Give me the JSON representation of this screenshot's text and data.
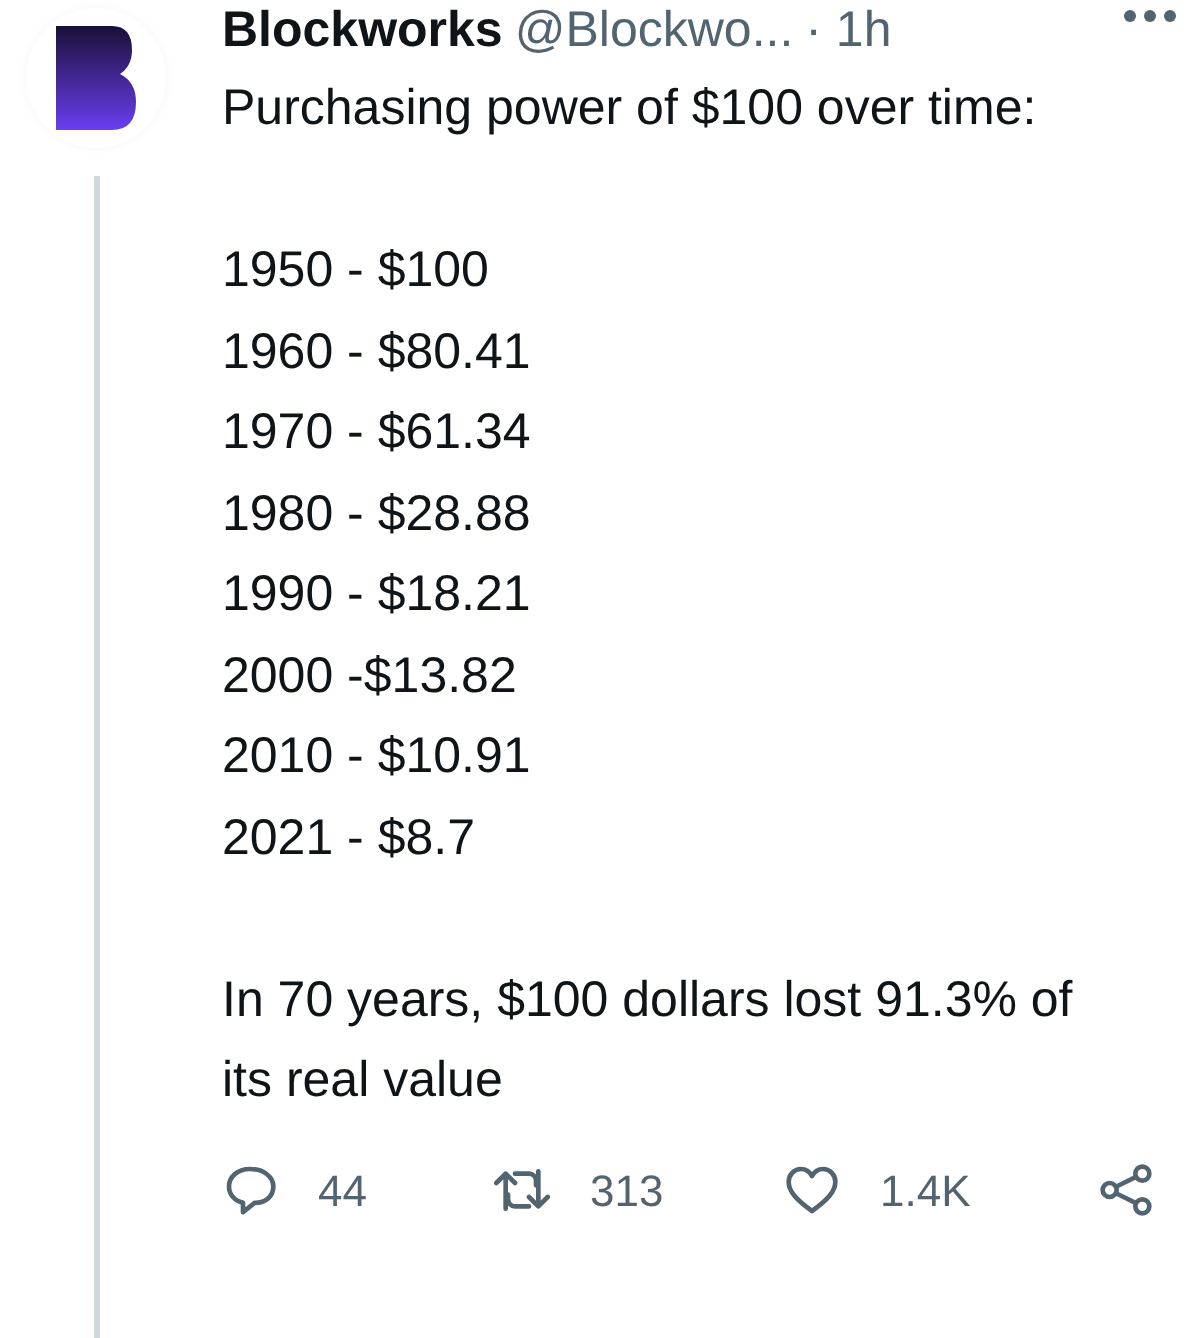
{
  "tweet": {
    "author": {
      "name": "Blockworks",
      "handle": "@Blockwo...",
      "time": "· 1h"
    },
    "body": [
      {
        "lines": [
          "Purchasing power of $100 over time:"
        ]
      },
      {
        "lines": [
          "1950 - $100",
          "1960 - $80.41",
          "1970 - $61.34",
          "1980 - $28.88",
          "1990 - $18.21",
          "2000 -$13.82",
          "2010 - $10.91",
          "2021 - $8.7"
        ]
      },
      {
        "lines": [
          "In 70 years, $100 dollars lost 91.3% of its real value"
        ]
      }
    ],
    "actions": [
      {
        "kind": "reply",
        "count": "44"
      },
      {
        "kind": "retweet",
        "count": "313"
      },
      {
        "kind": "like",
        "count": "1.4K"
      },
      {
        "kind": "share"
      }
    ]
  }
}
